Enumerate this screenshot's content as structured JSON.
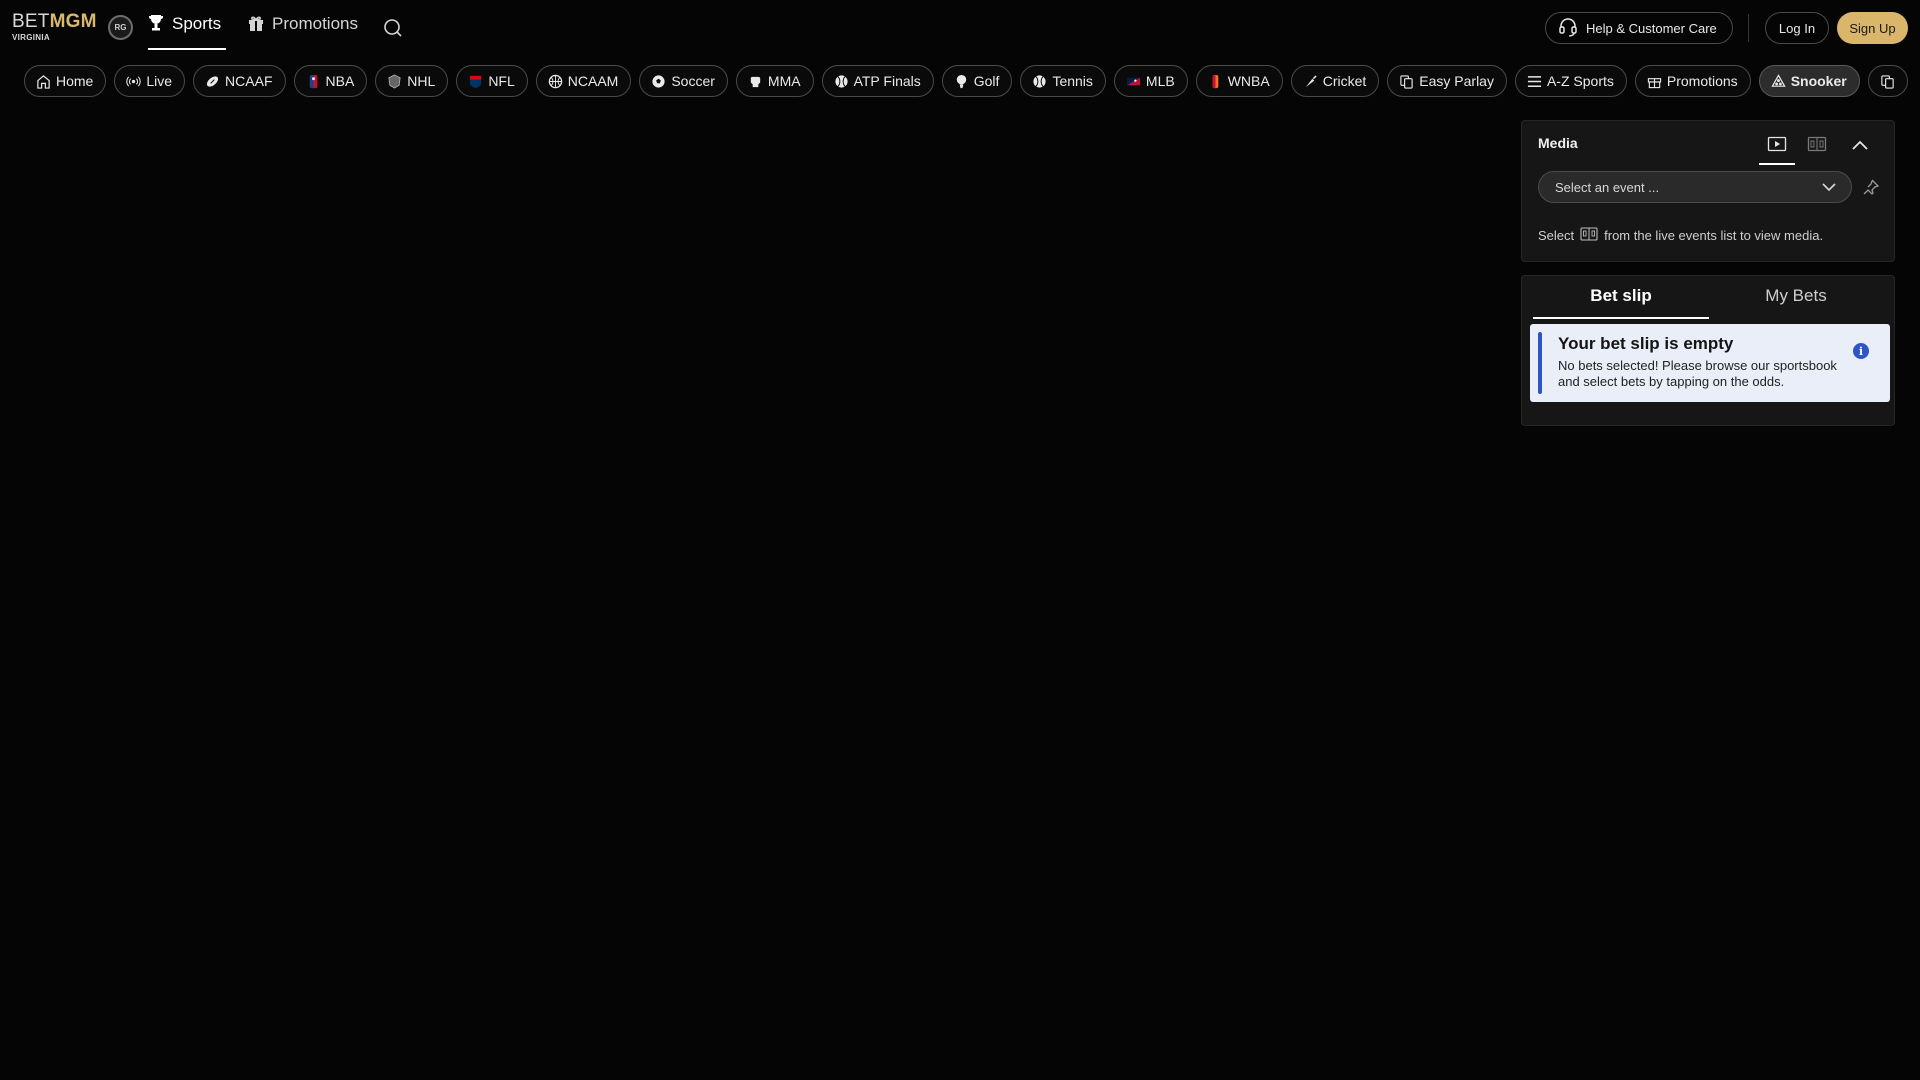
{
  "header": {
    "logo": {
      "brand_first": "BET",
      "brand_second": "MGM",
      "state": "VIRGINIA"
    },
    "rg_badge": "RG",
    "nav": [
      {
        "label": "Sports",
        "icon": "trophy-icon",
        "active": true
      },
      {
        "label": "Promotions",
        "icon": "gift-icon",
        "active": false
      }
    ],
    "help_label": "Help & Customer Care",
    "login_label": "Log In",
    "signup_label": "Sign Up",
    "accent_color": "#d9b66a"
  },
  "chips": [
    {
      "label": "Home",
      "icon": "home-icon"
    },
    {
      "label": "Live",
      "icon": "live-icon"
    },
    {
      "label": "NCAAF",
      "icon": "football-icon"
    },
    {
      "label": "NBA",
      "icon": "nba-logo-icon"
    },
    {
      "label": "NHL",
      "icon": "nhl-logo-icon"
    },
    {
      "label": "NFL",
      "icon": "nfl-logo-icon"
    },
    {
      "label": "NCAAM",
      "icon": "basketball-icon"
    },
    {
      "label": "Soccer",
      "icon": "soccer-ball-icon"
    },
    {
      "label": "MMA",
      "icon": "glove-icon"
    },
    {
      "label": "ATP Finals",
      "icon": "tennis-ball-icon"
    },
    {
      "label": "Golf",
      "icon": "golf-ball-icon"
    },
    {
      "label": "Tennis",
      "icon": "tennis-ball-icon"
    },
    {
      "label": "MLB",
      "icon": "mlb-logo-icon"
    },
    {
      "label": "WNBA",
      "icon": "wnba-logo-icon"
    },
    {
      "label": "Cricket",
      "icon": "cricket-bat-icon"
    },
    {
      "label": "Easy Parlay",
      "icon": "parlay-icon"
    },
    {
      "label": "A-Z Sports",
      "icon": "menu-icon"
    },
    {
      "label": "Promotions",
      "icon": "gift-icon"
    },
    {
      "label": "Snooker",
      "icon": "snooker-icon",
      "selected": true
    }
  ],
  "media": {
    "title": "Media",
    "select_placeholder": "Select an event ...",
    "info_before": "Select",
    "info_after": "from the live events list to view media."
  },
  "betslip": {
    "tabs": [
      {
        "label": "Bet slip",
        "active": true
      },
      {
        "label": "My Bets",
        "active": false
      }
    ],
    "empty_title": "Your bet slip is empty",
    "empty_text": "No bets selected! Please browse our sportsbook and select bets by tapping on the odds.",
    "info_color": "#2d55c8"
  }
}
